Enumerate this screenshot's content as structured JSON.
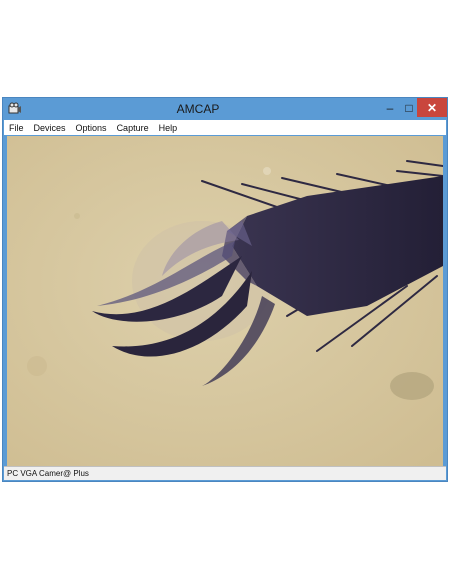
{
  "window": {
    "title": "AMCAP",
    "min_glyph": "–",
    "max_glyph": "□",
    "close_glyph": "✕"
  },
  "menu": {
    "items": [
      "File",
      "Devices",
      "Options",
      "Capture",
      "Help"
    ]
  },
  "viewport": {
    "content_icon": "microscope-claw-image",
    "background_color": "#d9c9a2"
  },
  "status": {
    "text": "PC VGA Camer@ Plus"
  },
  "colors": {
    "titlebar": "#5b9bd5",
    "close": "#c9463d"
  }
}
